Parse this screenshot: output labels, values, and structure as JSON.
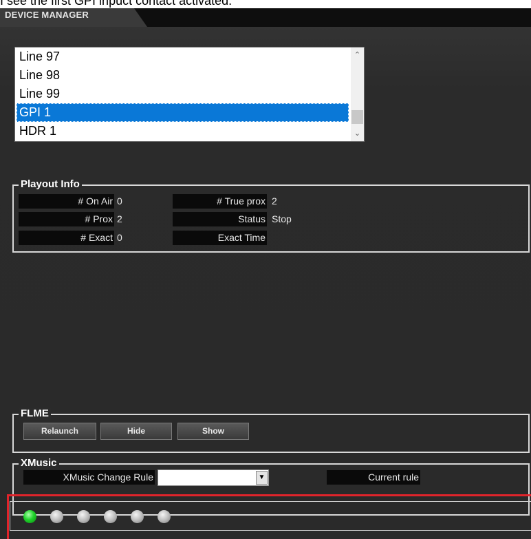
{
  "caption": "I see the first GPI inpuct contact activated.",
  "window": {
    "tab_title": "DEVICE MANAGER"
  },
  "device_list": {
    "items": [
      "Line 97",
      "Line 98",
      "Line 99",
      "GPI 1",
      "HDR 1"
    ],
    "selected": "GPI 1",
    "scroll_up": "⌃",
    "scroll_down": "⌄"
  },
  "playout_info": {
    "title": "Playout Info",
    "on_air_label": "# On Air",
    "on_air_value": "0",
    "prox_label": "# Prox",
    "prox_value": "2",
    "exact_label": "# Exact",
    "exact_value": "0",
    "true_prox_label": "# True prox",
    "true_prox_value": "2",
    "status_label": "Status",
    "status_value": "Stop",
    "exact_time_label": "Exact Time",
    "exact_time_value": ""
  },
  "flme": {
    "title": "FLME",
    "relaunch": "Relaunch",
    "hide": "Hide",
    "show": "Show"
  },
  "xmusic": {
    "title": "XMusic",
    "change_rule_label": "XMusic Change Rule",
    "change_rule_value": "",
    "current_rule_label": "Current rule",
    "combo_arrow": "▼"
  },
  "gpi_indicators": {
    "states": [
      "on",
      "off",
      "off",
      "off",
      "off",
      "off"
    ],
    "on_color": "#1fd32a",
    "off_color": "#bdbdbd",
    "highlight_color": "#e0242b"
  }
}
